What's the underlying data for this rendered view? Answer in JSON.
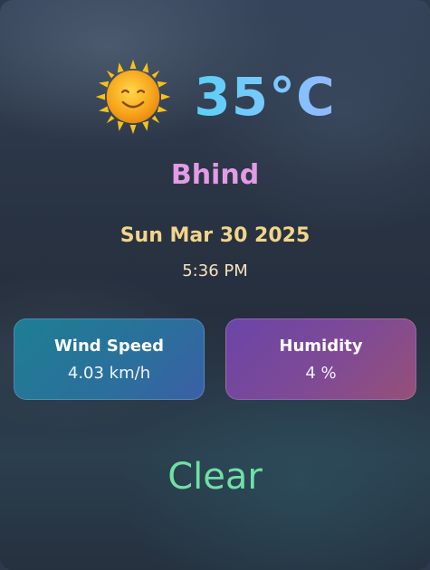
{
  "weather": {
    "icon": "smiling-sun-icon",
    "temperature": "35°C",
    "city": "Bhind",
    "date": "Sun Mar 30 2025",
    "time": "5:36 PM",
    "condition": "Clear"
  },
  "stats": {
    "wind": {
      "label": "Wind Speed",
      "value": "4.03 km/h"
    },
    "humidity": {
      "label": "Humidity",
      "value": "4 %"
    }
  },
  "colors": {
    "temperature_gradient": [
      "#5ad0f5",
      "#93b7ff"
    ],
    "city": "#e39be6",
    "date": "#f3d58a",
    "condition": "#6fe0a6",
    "wind_card": "#2b6f9c",
    "humidity_card": "#7f4a95"
  }
}
